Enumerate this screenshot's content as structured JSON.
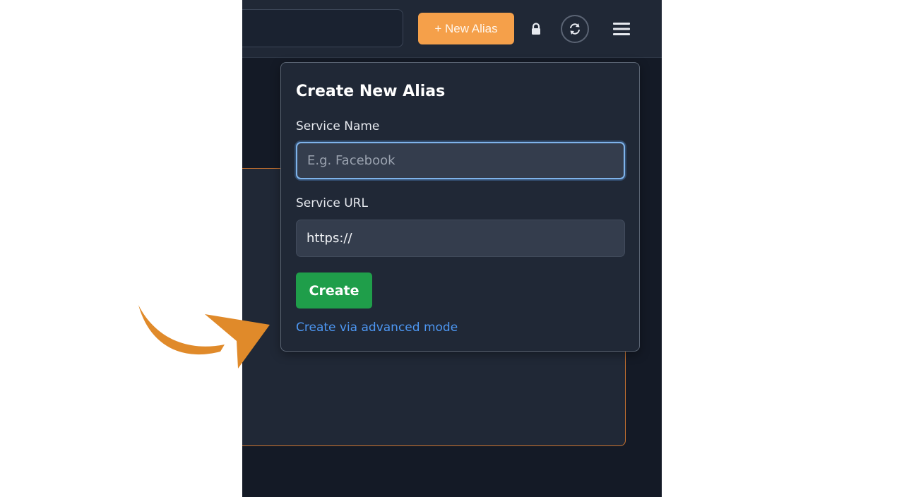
{
  "header": {
    "new_alias_label": "+ New Alias",
    "lock_icon": "lock-icon",
    "sync_icon": "sync-icon",
    "menu_icon": "hamburger-menu-icon"
  },
  "popover": {
    "title": "Create New Alias",
    "service_name": {
      "label": "Service Name",
      "placeholder": "E.g. Facebook",
      "value": ""
    },
    "service_url": {
      "label": "Service URL",
      "value": "https://"
    },
    "create_label": "Create",
    "advanced_link": "Create via advanced mode"
  },
  "annotation": {
    "arrow_color": "#e08a2a",
    "icon": "curved-arrow-icon"
  },
  "colors": {
    "accent_orange": "#f5a04a",
    "create_green": "#1f9e4a",
    "link_blue": "#4d97f3",
    "panel_bg": "#202836",
    "page_bg": "#141a26"
  }
}
